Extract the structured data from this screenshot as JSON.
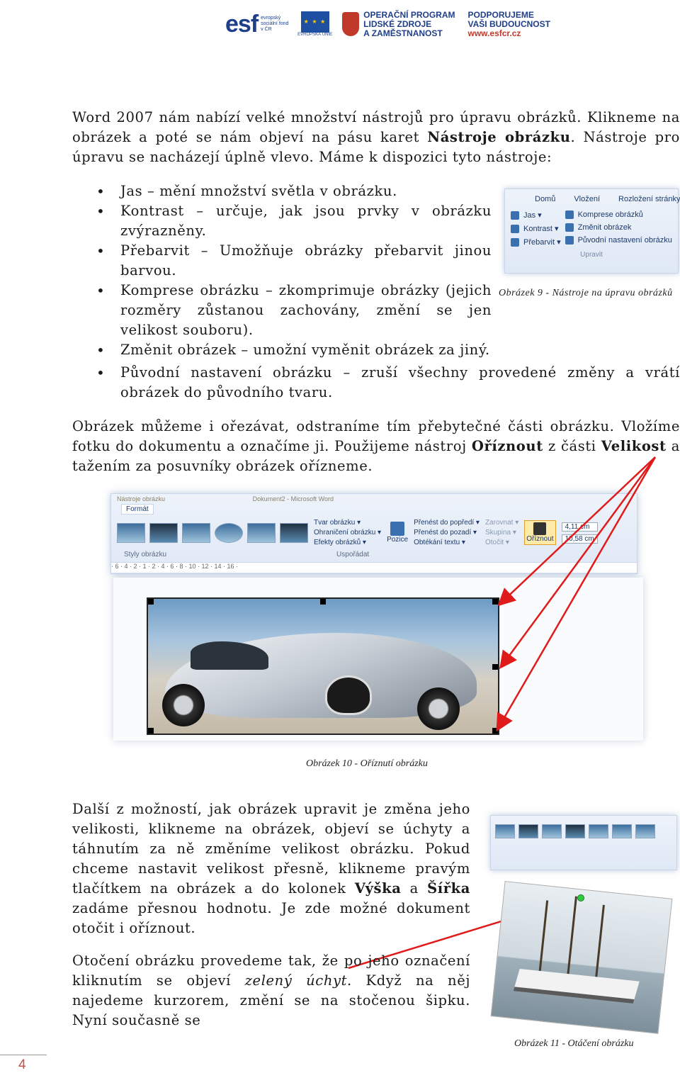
{
  "header": {
    "esf_text": "esf",
    "esf_sub": "evropský sociální fond v ČR",
    "eu_sub": "EVROPSKÁ UNIE",
    "op_line1": "OPERAČNÍ PROGRAM",
    "op_line2": "LIDSKÉ ZDROJE",
    "op_line3": "A ZAMĚSTNANOST",
    "sup_line1": "PODPORUJEME",
    "sup_line2": "VAŠI BUDOUCNOST",
    "sup_line3": "www.esfcr.cz"
  },
  "intro": {
    "p1a": "Word 2007 nám nabízí velké množství nástrojů pro úpravu obrázků. Klikneme na obrázek a poté se nám objeví na pásu karet ",
    "p1b": "Nástroje obrázku",
    "p1c": ". Nástroje pro úpravu se nacházejí úplně vlevo. Máme k dispozici tyto nástroje:"
  },
  "bullets": [
    "Jas – mění množství světla v obrázku.",
    "Kontrast – určuje, jak jsou prvky v obrázku zvýrazněny.",
    "Přebarvit – Umožňuje obrázky přebarvit jinou barvou.",
    "Komprese obrázku – zkomprimuje obrázky (jejich rozměry zůstanou zachovány, změní se jen velikost souboru).",
    "Změnit obrázek – umožní vyměnit obrázek za jiný.",
    "Původní nastavení obrázku – zruší všechny provedené změny a vrátí obrázek do původního tvaru."
  ],
  "fig9": {
    "tabs": [
      "Domů",
      "Vložení",
      "Rozložení stránky"
    ],
    "left": [
      "Jas ▾",
      "Kontrast ▾",
      "Přebarvit ▾"
    ],
    "right": [
      "Komprese obrázků",
      "Změnit obrázek",
      "Původní nastavení obrázku"
    ],
    "group": "Upravit",
    "caption": "Obrázek 9 - Nástroje na úpravu obrázků"
  },
  "crop_par": {
    "a": "Obrázek můžeme i ořezávat, odstraníme tím přebytečné části obrázku. Vložíme fotku do dokumentu a označíme ji. Použijeme nástroj ",
    "b": "Oříznout",
    "c": " z části ",
    "d": "Velikost",
    "e": " a tažením za posuvníky obrázek ořízneme."
  },
  "fig10": {
    "title_left": "Nástroje obrázku",
    "title_right": "Dokument2 - Microsoft Word",
    "tab": "Formát",
    "arrange": [
      "Tvar obrázku ▾",
      "Ohraničení obrázku ▾",
      "Efekty obrázků ▾"
    ],
    "order": [
      "Přenést do popředí ▾",
      "Přenést do pozadí ▾",
      "Obtékání textu ▾"
    ],
    "align": [
      "Zarovnat ▾",
      "Skupina ▾",
      "Otočit ▾"
    ],
    "position": "Pozice",
    "crop": "Oříznout",
    "height": "4,11 cm",
    "width": "10,58 cm",
    "styles_label": "Styly obrázku",
    "arrange_label": "Uspořádat",
    "ruler": "· 6 · 4 · 2 · 1 · 2 · 4 · 6 · 8 · 10 · 12 · 14 · 16 ·",
    "caption": "Obrázek 10 - Oříznutí obrázku"
  },
  "size_par": {
    "a": "Další z možností, jak obrázek upravit je změna jeho velikosti, klikneme na obrázek, objeví se úchyty a táhnutím za ně změníme velikost obrázku. Pokud chceme nastavit velikost přesně, klikneme pravým tlačítkem na obrázek a do kolonek ",
    "b": "Výška",
    "c": " a ",
    "d": "Šířka",
    "e": " zadáme přesnou hodnotu. Je zde možné dokument otočit i oříznout."
  },
  "rotate_par": {
    "a": "Otočení obrázku provedeme tak, že po jeho označení kliknutím se objeví ",
    "b": "zelený úchyt",
    "c": ". Když na něj najedeme kurzorem, změní se na stočenou šipku. Nyní současně se"
  },
  "fig11": {
    "caption": "Obrázek 11 - Otáčení obrázku"
  },
  "page_number": "4",
  "colors": {
    "arrow": "#e01b1b",
    "accent_blue": "#1f3f8a",
    "page_number": "#c0504d"
  }
}
